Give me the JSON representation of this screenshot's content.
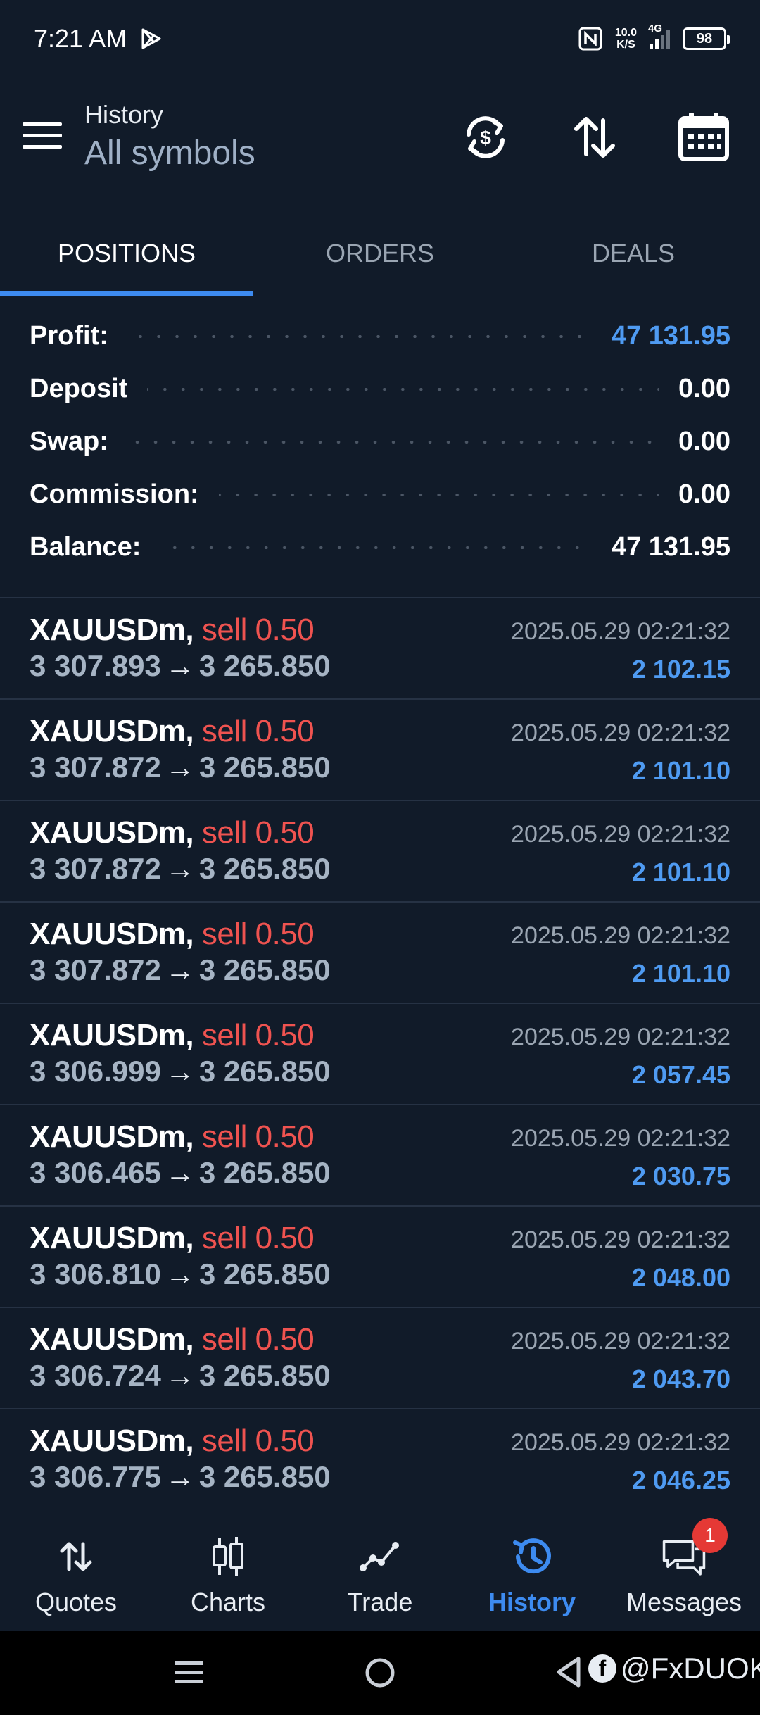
{
  "status_bar": {
    "time": "7:21 AM",
    "net_speed_value": "10.0",
    "net_speed_unit": "K/S",
    "network": "4G",
    "battery": "98"
  },
  "header": {
    "title": "History",
    "subtitle": "All symbols",
    "icons": [
      "menu-icon",
      "currency-exchange-icon",
      "sort-icon",
      "calendar-icon"
    ]
  },
  "tabs": [
    {
      "label": "POSITIONS",
      "active": true
    },
    {
      "label": "ORDERS",
      "active": false
    },
    {
      "label": "DEALS",
      "active": false
    }
  ],
  "summary": {
    "profit_label": "Profit:",
    "profit_value": "47 131.95",
    "deposit_label": "Deposit",
    "deposit_value": "0.00",
    "swap_label": "Swap:",
    "swap_value": "0.00",
    "commission_label": "Commission:",
    "commission_value": "0.00",
    "balance_label": "Balance:",
    "balance_value": "47 131.95"
  },
  "deals": [
    {
      "symbol": "XAUUSDm,",
      "side": "sell 0.50",
      "open": "3 307.893",
      "arrow": "→",
      "close": "3 265.850",
      "time": "2025.05.29 02:21:32",
      "profit": "2 102.15"
    },
    {
      "symbol": "XAUUSDm,",
      "side": "sell 0.50",
      "open": "3 307.872",
      "arrow": "→",
      "close": "3 265.850",
      "time": "2025.05.29 02:21:32",
      "profit": "2 101.10"
    },
    {
      "symbol": "XAUUSDm,",
      "side": "sell 0.50",
      "open": "3 307.872",
      "arrow": "→",
      "close": "3 265.850",
      "time": "2025.05.29 02:21:32",
      "profit": "2 101.10"
    },
    {
      "symbol": "XAUUSDm,",
      "side": "sell 0.50",
      "open": "3 307.872",
      "arrow": "→",
      "close": "3 265.850",
      "time": "2025.05.29 02:21:32",
      "profit": "2 101.10"
    },
    {
      "symbol": "XAUUSDm,",
      "side": "sell 0.50",
      "open": "3 306.999",
      "arrow": "→",
      "close": "3 265.850",
      "time": "2025.05.29 02:21:32",
      "profit": "2 057.45"
    },
    {
      "symbol": "XAUUSDm,",
      "side": "sell 0.50",
      "open": "3 306.465",
      "arrow": "→",
      "close": "3 265.850",
      "time": "2025.05.29 02:21:32",
      "profit": "2 030.75"
    },
    {
      "symbol": "XAUUSDm,",
      "side": "sell 0.50",
      "open": "3 306.810",
      "arrow": "→",
      "close": "3 265.850",
      "time": "2025.05.29 02:21:32",
      "profit": "2 048.00"
    },
    {
      "symbol": "XAUUSDm,",
      "side": "sell 0.50",
      "open": "3 306.724",
      "arrow": "→",
      "close": "3 265.850",
      "time": "2025.05.29 02:21:32",
      "profit": "2 043.70"
    },
    {
      "symbol": "XAUUSDm,",
      "side": "sell 0.50",
      "open": "3 306.775",
      "arrow": "→",
      "close": "3 265.850",
      "time": "2025.05.29 02:21:32",
      "profit": "2 046.25"
    }
  ],
  "bottom_nav": [
    {
      "label": "Quotes",
      "icon": "quotes-arrows-icon",
      "active": false
    },
    {
      "label": "Charts",
      "icon": "candlestick-icon",
      "active": false
    },
    {
      "label": "Trade",
      "icon": "trade-line-icon",
      "active": false
    },
    {
      "label": "History",
      "icon": "history-clock-icon",
      "active": true
    },
    {
      "label": "Messages",
      "icon": "chat-bubbles-icon",
      "active": false,
      "badge": "1"
    }
  ],
  "system_nav": {
    "watermark": "@FxDUOK"
  },
  "colors": {
    "background": "#111b29",
    "accent_blue": "#3d8bf0",
    "profit_blue": "#4f9bf2",
    "sell_red": "#ef5350",
    "price_grey": "#a6b4c4"
  }
}
